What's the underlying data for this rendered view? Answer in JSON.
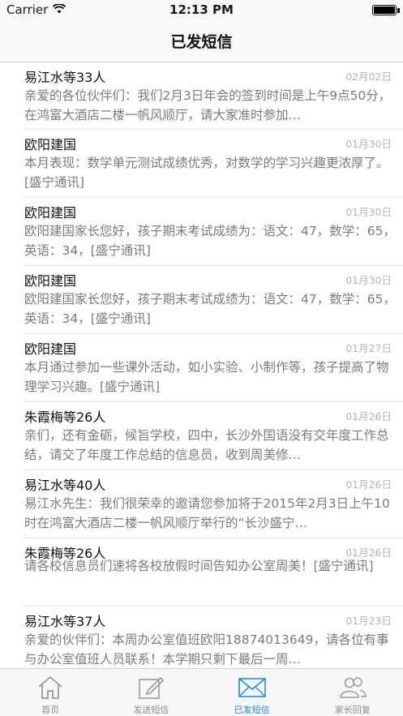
{
  "status_bar": {
    "carrier": "Carrier",
    "time": "12:13 PM",
    "battery_level": 1.0
  },
  "nav": {
    "title": "已发短信"
  },
  "messages": [
    {
      "name": "易江水等33人",
      "date": "02月02日",
      "body": "亲爱的各位伙伴们：我们2月3日年会的签到时间是上午9点50分，在鸿富大酒店二楼一帆风顺厅，请大家准时参加…"
    },
    {
      "name": "欧阳建国",
      "date": "01月30日",
      "body": "本月表现：数学单元测试成绩优秀，对数学的学习兴趣更浓厚了。[盛宁通讯]"
    },
    {
      "name": "欧阳建国",
      "date": "01月30日",
      "body": "欧阳建国家长您好，孩子期末考试成绩为：语文：47，数学：65，英语：34，[盛宁通讯]"
    },
    {
      "name": "欧阳建国",
      "date": "01月30日",
      "body": "欧阳建国家长您好，孩子期末考试成绩为：语文：47，数学：65，英语：34，[盛宁通讯]"
    },
    {
      "name": "欧阳建国",
      "date": "01月27日",
      "body": "本月通过参加一些课外活动，如小实验、小制作等，孩子提高了物理学习兴趣。[盛宁通讯]"
    },
    {
      "name": "朱霞梅等26人",
      "date": "01月26日",
      "body": "亲们，还有金砺，候旨学校，四中，长沙外国语没有交年度工作总结，请交了年度工作总结的信息员，收到周美修…"
    },
    {
      "name": "易江水等40人",
      "date": "01月26日",
      "body": "易江水先生：我们很荣幸的邀请您参加将于2015年2月3日上午10时在鸿富大酒店二楼一帆风顺厅举行的“长沙盛宁…"
    },
    {
      "name": "朱霞梅等26人",
      "date": "01月26日",
      "body": "请各校信息员们速将各校放假时间告知办公室周美！[盛宁通讯]"
    },
    {
      "name": "易江水等37人",
      "date": "01月23日",
      "body": "亲爱的伙伴们：本周办公室值班欧阳18874013649，请各位有事与办公室值班人员联系！本学期只剩下最后一周…"
    }
  ],
  "tabs": [
    {
      "label": "首页",
      "icon": "home-icon",
      "active": false
    },
    {
      "label": "发送短信",
      "icon": "compose-icon",
      "active": false
    },
    {
      "label": "已发短信",
      "icon": "envelope-icon",
      "active": true
    },
    {
      "label": "家长回复",
      "icon": "contacts-icon",
      "active": false
    }
  ],
  "colors": {
    "accent": "#1a8fd8",
    "inactive": "#8e8e8e",
    "date": "#b4b4b4",
    "body_text": "#7b7b7b"
  }
}
